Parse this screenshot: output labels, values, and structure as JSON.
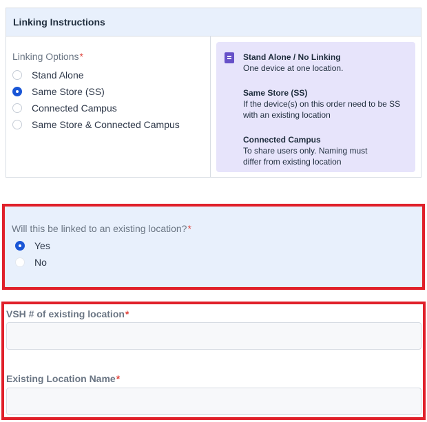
{
  "linking": {
    "header": "Linking Instructions",
    "options_label": "Linking Options",
    "required_mark": "*",
    "options": [
      {
        "label": "Stand Alone",
        "checked": false
      },
      {
        "label": "Same Store (SS)",
        "checked": true
      },
      {
        "label": "Connected Campus",
        "checked": false
      },
      {
        "label": "Same Store & Connected Campus",
        "checked": false
      }
    ],
    "info_icon": "document-icon",
    "info": [
      {
        "title": "Stand Alone / No Linking",
        "text": "One device at one location."
      },
      {
        "title": "Same Store (SS)",
        "text": "If the device(s) on this order need to be SS with an existing location"
      },
      {
        "title": "Connected Campus",
        "text": "To share users only. Naming must differ from existing location"
      }
    ]
  },
  "existing_question": {
    "label": "Will this be linked to an existing location?",
    "required_mark": "*",
    "options": [
      {
        "label": "Yes",
        "checked": true
      },
      {
        "label": "No",
        "checked": false
      }
    ]
  },
  "vsh": {
    "label": "VSH # of existing location",
    "required_mark": "*",
    "value": ""
  },
  "location_name": {
    "label": "Existing Location Name",
    "required_mark": "*",
    "value": ""
  },
  "colors": {
    "highlight_border": "#e0202a",
    "accent": "#1a56d6",
    "header_bg": "#e8f0fc",
    "info_bg": "#e7e4fb",
    "required": "#e0473f"
  }
}
